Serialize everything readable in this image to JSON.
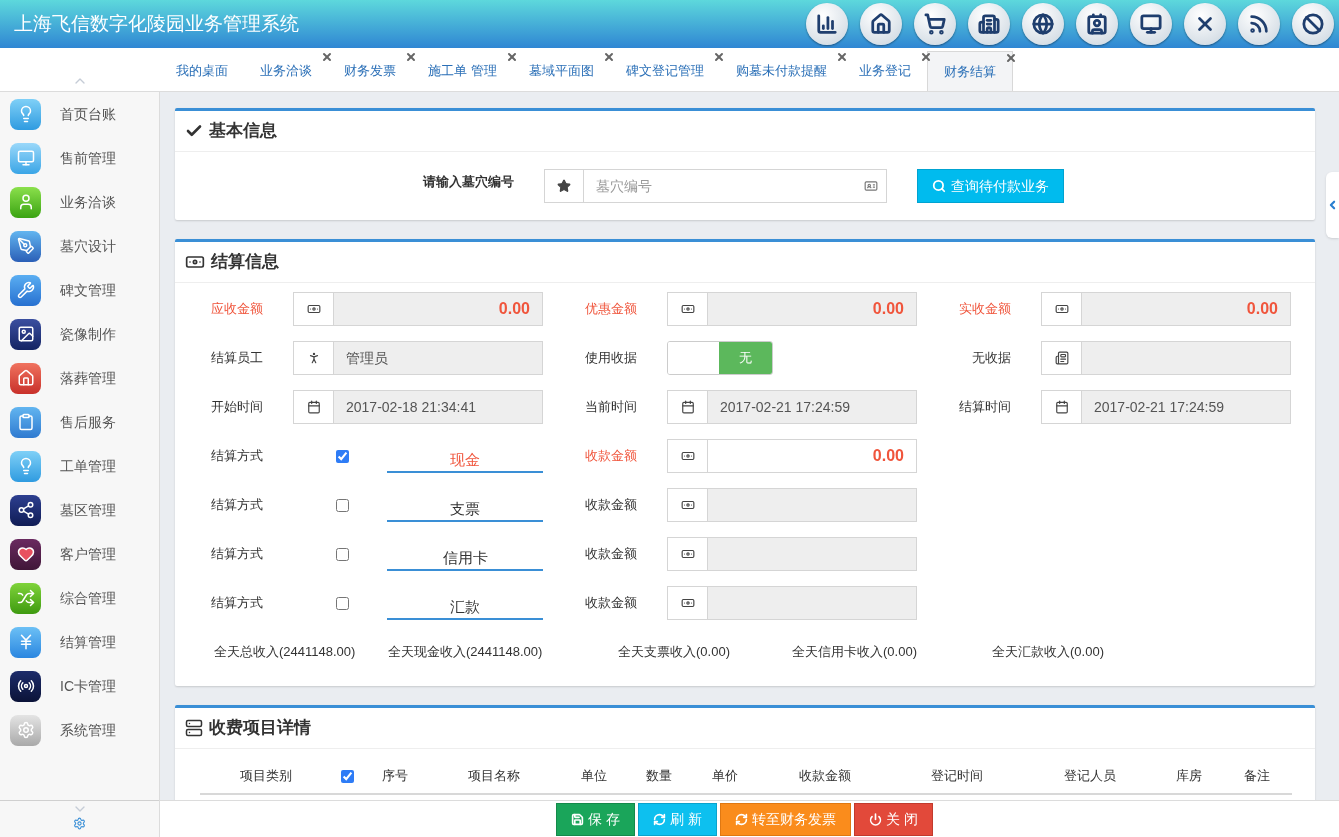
{
  "header": {
    "title": "上海飞信数字化陵园业务管理系统"
  },
  "tabs": [
    {
      "label": "我的桌面",
      "closable": false,
      "selected": false
    },
    {
      "label": "业务洽谈",
      "closable": true,
      "selected": false
    },
    {
      "label": "财务发票",
      "closable": true,
      "selected": false
    },
    {
      "label": "施工单 管理",
      "closable": true,
      "selected": false
    },
    {
      "label": "墓域平面图",
      "closable": true,
      "selected": false
    },
    {
      "label": "碑文登记管理",
      "closable": true,
      "selected": false
    },
    {
      "label": "购墓未付款提醒",
      "closable": true,
      "selected": false
    },
    {
      "label": "业务登记",
      "closable": true,
      "selected": false
    },
    {
      "label": "财务结算",
      "closable": true,
      "selected": true
    }
  ],
  "sidebar": {
    "items": [
      {
        "label": "首页台账"
      },
      {
        "label": "售前管理"
      },
      {
        "label": "业务洽谈"
      },
      {
        "label": "墓穴设计"
      },
      {
        "label": "碑文管理"
      },
      {
        "label": "瓷像制作"
      },
      {
        "label": "落葬管理"
      },
      {
        "label": "售后服务"
      },
      {
        "label": "工单管理"
      },
      {
        "label": "墓区管理"
      },
      {
        "label": "客户管理"
      },
      {
        "label": "综合管理"
      },
      {
        "label": "结算管理"
      },
      {
        "label": "IC卡管理"
      },
      {
        "label": "系统管理"
      }
    ]
  },
  "basic_info": {
    "title": "基本信息",
    "field_label": "请输入墓穴编号",
    "placeholder": "墓穴编号",
    "search_button": "查询待付款业务"
  },
  "settlement": {
    "title": "结算信息",
    "rows": [
      [
        {
          "label": "应收金额",
          "kind": "money",
          "value": "0.00",
          "highlight": true
        },
        {
          "label": "优惠金额",
          "kind": "money",
          "value": "0.00",
          "highlight": true
        },
        {
          "label": "实收金额",
          "kind": "money",
          "value": "0.00",
          "highlight": true
        }
      ],
      [
        {
          "label": "结算员工",
          "kind": "person",
          "value": "管理员",
          "highlight": false
        },
        {
          "label": "使用收据",
          "kind": "toggle",
          "value": "无",
          "on": false,
          "highlight": false
        },
        {
          "label": "无收据",
          "kind": "receipt",
          "highlight": false
        }
      ],
      [
        {
          "label": "开始时间",
          "kind": "date",
          "value": "2017-02-18 21:34:41",
          "highlight": false
        },
        {
          "label": "当前时间",
          "kind": "date",
          "value": "2017-02-21 17:24:59",
          "highlight": false
        },
        {
          "label": "结算时间",
          "kind": "date",
          "value": "2017-02-21 17:24:59",
          "highlight": false
        }
      ]
    ],
    "payments": [
      {
        "label": "结算方式",
        "checked": true,
        "method": "现金",
        "amount_label": "收款金额",
        "value": "0.00"
      },
      {
        "label": "结算方式",
        "checked": false,
        "method": "支票",
        "amount_label": "收款金额"
      },
      {
        "label": "结算方式",
        "checked": false,
        "method": "信用卡",
        "amount_label": "收款金额"
      },
      {
        "label": "结算方式",
        "checked": false,
        "method": "汇款",
        "amount_label": "收款金额"
      }
    ],
    "totals": [
      "全天总收入(2441148.00)",
      "全天现金收入(2441148.00)",
      "全天支票收入(0.00)",
      "全天信用卡收入(0.00)",
      "全天汇款收入(0.00)"
    ]
  },
  "items": {
    "title": "收费项目详情",
    "columns": [
      {
        "kind": "text",
        "label": "项目类别"
      },
      {
        "kind": "checkbox",
        "checked": true
      },
      {
        "kind": "text",
        "label": "序号"
      },
      {
        "kind": "text",
        "label": "项目名称"
      },
      {
        "kind": "text",
        "label": "单位"
      },
      {
        "kind": "text",
        "label": "数量"
      },
      {
        "kind": "text",
        "label": "单价"
      },
      {
        "kind": "text",
        "label": "收款金额"
      },
      {
        "kind": "text",
        "label": "登记时间"
      },
      {
        "kind": "text",
        "label": "登记人员"
      },
      {
        "kind": "text",
        "label": "库房"
      },
      {
        "kind": "text",
        "label": "备注"
      }
    ]
  },
  "actions": [
    {
      "label": "保 存",
      "kind": "save"
    },
    {
      "label": "刷 新",
      "kind": "refresh"
    },
    {
      "label": "转至财务发票",
      "kind": "forward"
    },
    {
      "label": "关 闭",
      "kind": "close"
    }
  ]
}
